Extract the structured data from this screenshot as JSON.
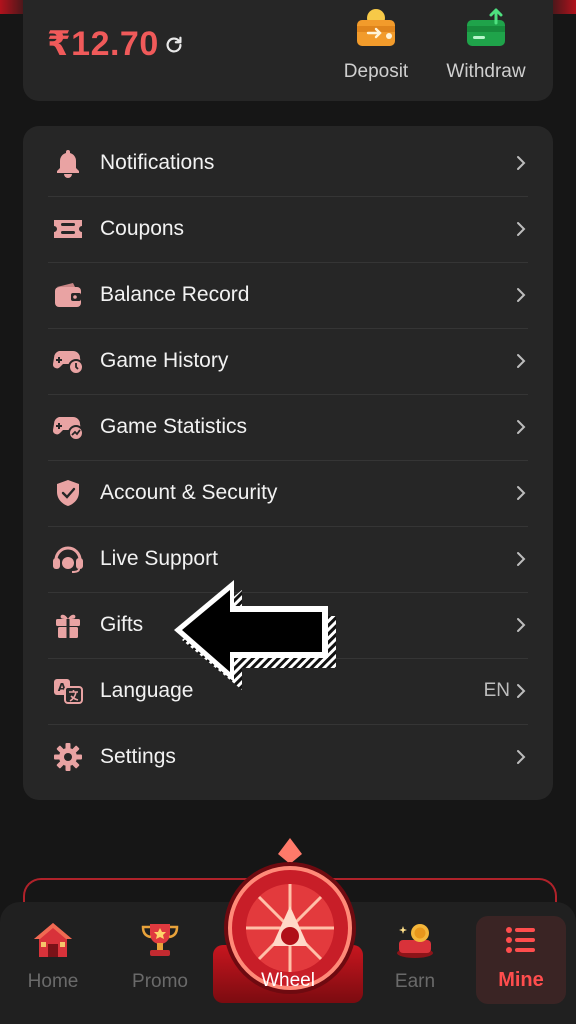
{
  "balance": {
    "amount": "₹12.70"
  },
  "actions": {
    "deposit_label": "Deposit",
    "withdraw_label": "Withdraw"
  },
  "menu": [
    {
      "label": "Notifications",
      "icon": "bell-icon",
      "value": ""
    },
    {
      "label": "Coupons",
      "icon": "ticket-icon",
      "value": ""
    },
    {
      "label": "Balance Record",
      "icon": "wallet-icon",
      "value": ""
    },
    {
      "label": "Game History",
      "icon": "gamepad-clock-icon",
      "value": ""
    },
    {
      "label": "Game Statistics",
      "icon": "gamepad-chart-icon",
      "value": ""
    },
    {
      "label": "Account & Security",
      "icon": "shield-icon",
      "value": ""
    },
    {
      "label": "Live Support",
      "icon": "headset-icon",
      "value": ""
    },
    {
      "label": "Gifts",
      "icon": "gift-icon",
      "value": ""
    },
    {
      "label": "Language",
      "icon": "translate-icon",
      "value": "EN"
    },
    {
      "label": "Settings",
      "icon": "gear-icon",
      "value": ""
    }
  ],
  "tabs": {
    "home": "Home",
    "promo": "Promo",
    "wheel": "Wheel",
    "earn": "Earn",
    "mine": "Mine"
  },
  "colors": {
    "accent": "#f05a5a",
    "menu_icon": "#e9a3a3",
    "active_tab": "#ff4d4d"
  }
}
